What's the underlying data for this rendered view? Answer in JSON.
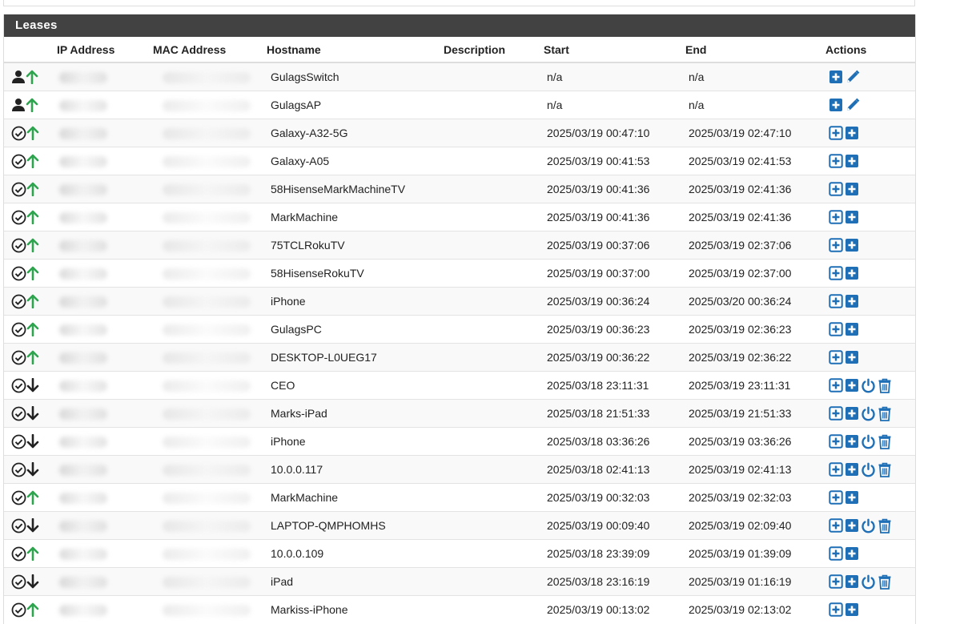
{
  "panel": {
    "title": "Leases"
  },
  "colors": {
    "accent_blue": "#1e6fb5",
    "online_green": "#2ea44f",
    "offline_dark": "#222222",
    "header_bg": "#424242"
  },
  "table": {
    "headers": {
      "ip": "IP Address",
      "mac": "MAC Address",
      "hostname": "Hostname",
      "description": "Description",
      "start": "Start",
      "end": "End",
      "actions": "Actions"
    },
    "rows": [
      {
        "type": "static",
        "online": true,
        "hostname": "GulagsSwitch",
        "start": "n/a",
        "end": "n/a",
        "actions": [
          "add-plus-icon",
          "edit-pencil-icon"
        ]
      },
      {
        "type": "static",
        "online": true,
        "hostname": "GulagsAP",
        "start": "n/a",
        "end": "n/a",
        "actions": [
          "add-plus-icon",
          "edit-pencil-icon"
        ]
      },
      {
        "type": "active",
        "online": true,
        "hostname": "Galaxy-A32-5G",
        "start": "2025/03/19 00:47:10",
        "end": "2025/03/19 02:47:10",
        "actions": [
          "add-static-mapping-icon",
          "add-wol-mapping-icon"
        ]
      },
      {
        "type": "active",
        "online": true,
        "hostname": "Galaxy-A05",
        "start": "2025/03/19 00:41:53",
        "end": "2025/03/19 02:41:53",
        "actions": [
          "add-static-mapping-icon",
          "add-wol-mapping-icon"
        ]
      },
      {
        "type": "active",
        "online": true,
        "hostname": "58HisenseMarkMachineTV",
        "start": "2025/03/19 00:41:36",
        "end": "2025/03/19 02:41:36",
        "actions": [
          "add-static-mapping-icon",
          "add-wol-mapping-icon"
        ]
      },
      {
        "type": "active",
        "online": true,
        "hostname": "MarkMachine",
        "start": "2025/03/19 00:41:36",
        "end": "2025/03/19 02:41:36",
        "actions": [
          "add-static-mapping-icon",
          "add-wol-mapping-icon"
        ]
      },
      {
        "type": "active",
        "online": true,
        "hostname": "75TCLRokuTV",
        "start": "2025/03/19 00:37:06",
        "end": "2025/03/19 02:37:06",
        "actions": [
          "add-static-mapping-icon",
          "add-wol-mapping-icon"
        ]
      },
      {
        "type": "active",
        "online": true,
        "hostname": "58HisenseRokuTV",
        "start": "2025/03/19 00:37:00",
        "end": "2025/03/19 02:37:00",
        "actions": [
          "add-static-mapping-icon",
          "add-wol-mapping-icon"
        ]
      },
      {
        "type": "active",
        "online": true,
        "hostname": "iPhone",
        "start": "2025/03/19 00:36:24",
        "end": "2025/03/20 00:36:24",
        "actions": [
          "add-static-mapping-icon",
          "add-wol-mapping-icon"
        ]
      },
      {
        "type": "active",
        "online": true,
        "hostname": "GulagsPC",
        "start": "2025/03/19 00:36:23",
        "end": "2025/03/19 02:36:23",
        "actions": [
          "add-static-mapping-icon",
          "add-wol-mapping-icon"
        ]
      },
      {
        "type": "active",
        "online": true,
        "hostname": "DESKTOP-L0UEG17",
        "start": "2025/03/19 00:36:22",
        "end": "2025/03/19 02:36:22",
        "actions": [
          "add-static-mapping-icon",
          "add-wol-mapping-icon"
        ]
      },
      {
        "type": "active",
        "online": false,
        "hostname": "CEO",
        "start": "2025/03/18 23:11:31",
        "end": "2025/03/19 23:11:31",
        "actions": [
          "add-static-mapping-icon",
          "add-wol-mapping-icon",
          "power-icon",
          "trash-icon"
        ]
      },
      {
        "type": "active",
        "online": false,
        "hostname": "Marks-iPad",
        "start": "2025/03/18 21:51:33",
        "end": "2025/03/19 21:51:33",
        "actions": [
          "add-static-mapping-icon",
          "add-wol-mapping-icon",
          "power-icon",
          "trash-icon"
        ]
      },
      {
        "type": "active",
        "online": false,
        "hostname": "iPhone",
        "start": "2025/03/18 03:36:26",
        "end": "2025/03/19 03:36:26",
        "actions": [
          "add-static-mapping-icon",
          "add-wol-mapping-icon",
          "power-icon",
          "trash-icon"
        ]
      },
      {
        "type": "active",
        "online": false,
        "hostname": "10.0.0.117",
        "start": "2025/03/18 02:41:13",
        "end": "2025/03/19 02:41:13",
        "actions": [
          "add-static-mapping-icon",
          "add-wol-mapping-icon",
          "power-icon",
          "trash-icon"
        ]
      },
      {
        "type": "active",
        "online": true,
        "hostname": "MarkMachine",
        "start": "2025/03/19 00:32:03",
        "end": "2025/03/19 02:32:03",
        "actions": [
          "add-static-mapping-icon",
          "add-wol-mapping-icon"
        ]
      },
      {
        "type": "active",
        "online": false,
        "hostname": "LAPTOP-QMPHOMHS",
        "start": "2025/03/19 00:09:40",
        "end": "2025/03/19 02:09:40",
        "actions": [
          "add-static-mapping-icon",
          "add-wol-mapping-icon",
          "power-icon",
          "trash-icon"
        ]
      },
      {
        "type": "active",
        "online": true,
        "hostname": "10.0.0.109",
        "start": "2025/03/18 23:39:09",
        "end": "2025/03/19 01:39:09",
        "actions": [
          "add-static-mapping-icon",
          "add-wol-mapping-icon"
        ]
      },
      {
        "type": "active",
        "online": false,
        "hostname": "iPad",
        "start": "2025/03/18 23:16:19",
        "end": "2025/03/19 01:16:19",
        "actions": [
          "add-static-mapping-icon",
          "add-wol-mapping-icon",
          "power-icon",
          "trash-icon"
        ]
      },
      {
        "type": "active",
        "online": true,
        "hostname": "Markiss-iPhone",
        "start": "2025/03/19 00:13:02",
        "end": "2025/03/19 02:13:02",
        "actions": [
          "add-static-mapping-icon",
          "add-wol-mapping-icon"
        ]
      }
    ]
  }
}
